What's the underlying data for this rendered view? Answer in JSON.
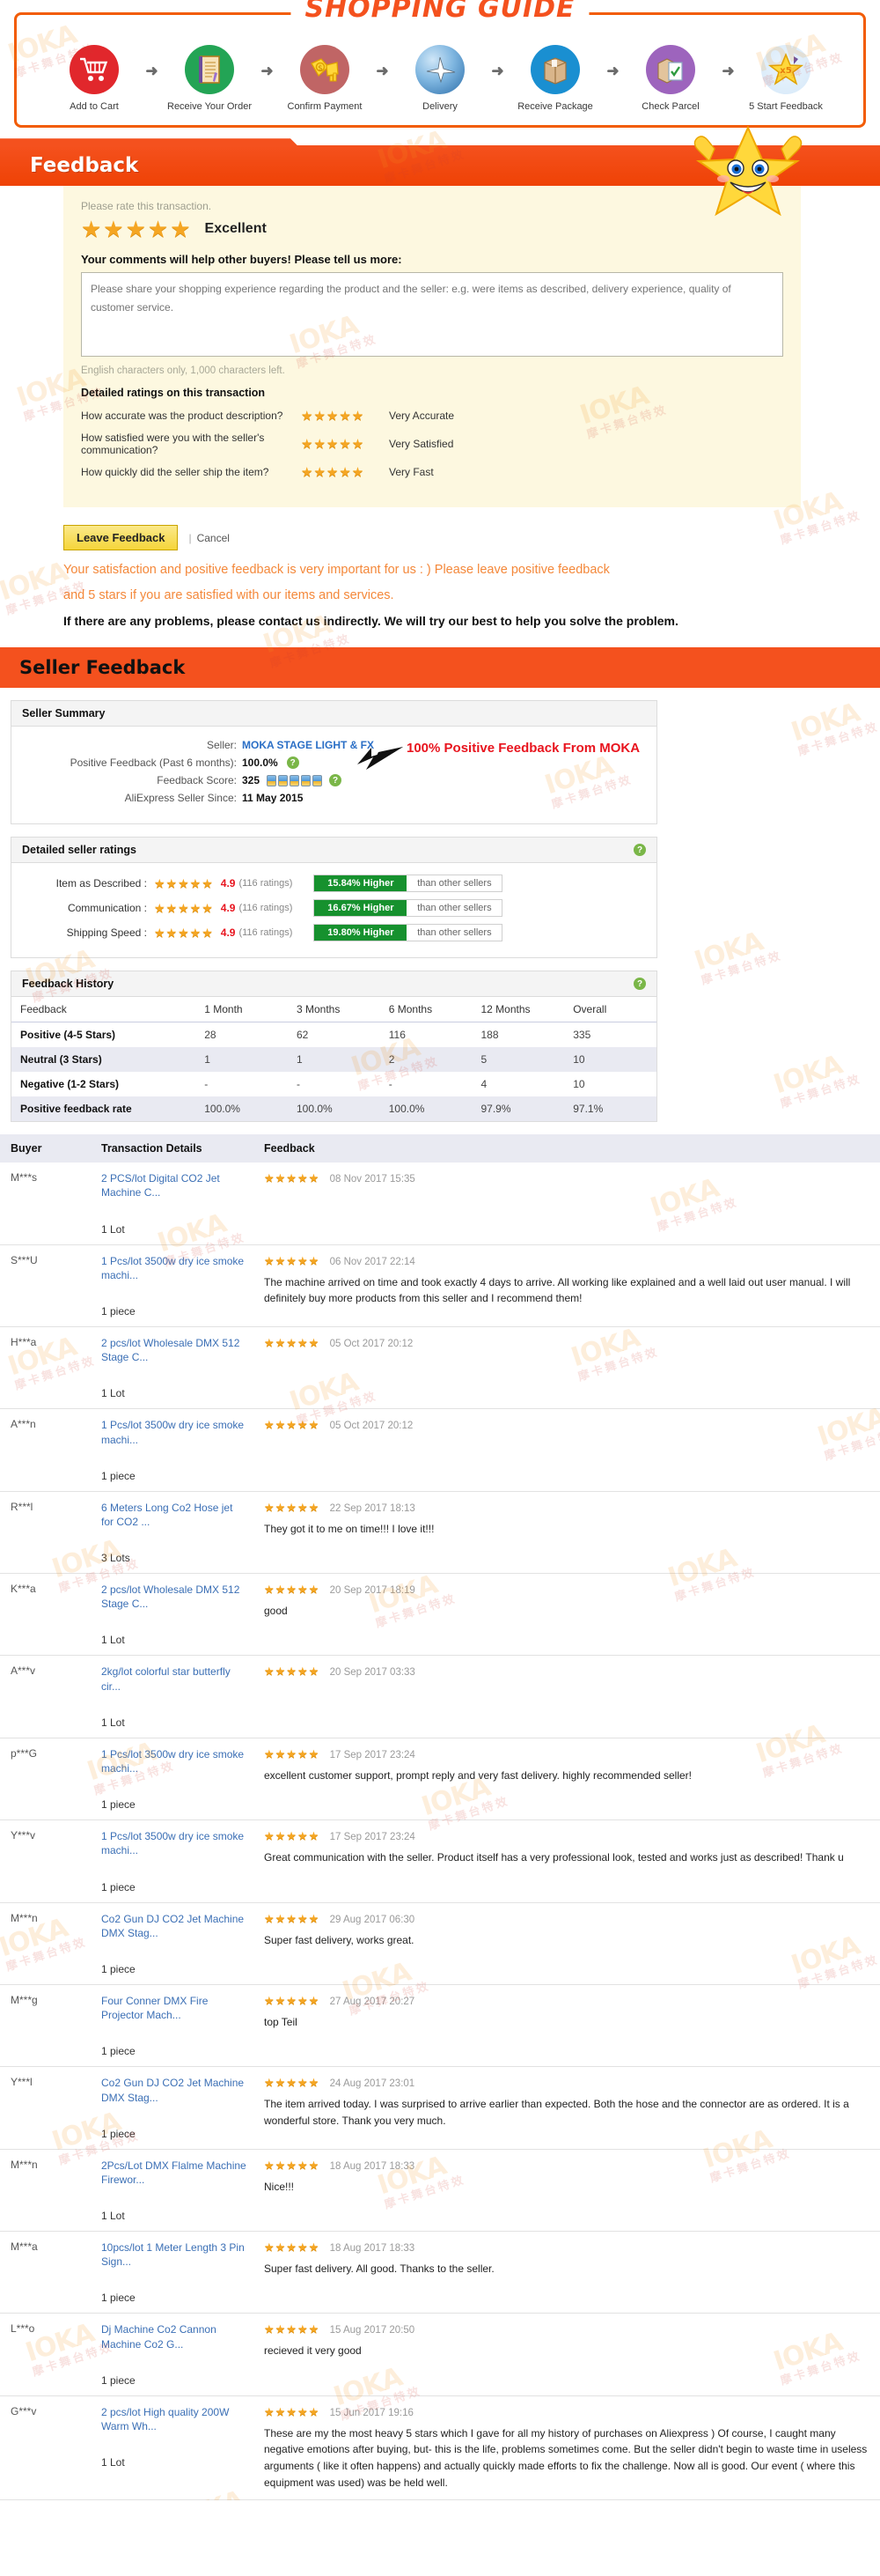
{
  "guide": {
    "title": "SHOPPING GUIDE",
    "steps": [
      {
        "label": "Add to Cart",
        "icon": "shopping-cart-icon"
      },
      {
        "label": "Receive Your Order",
        "icon": "order-document-icon"
      },
      {
        "label": "Confirm Payment",
        "icon": "money-payment-icon"
      },
      {
        "label": "Delivery",
        "icon": "airplane-globe-icon"
      },
      {
        "label": "Receive Package",
        "icon": "parcel-box-icon"
      },
      {
        "label": "Check Parcel",
        "icon": "checklist-parcel-icon"
      },
      {
        "label": "5 Start Feedback",
        "icon": "five-star-icon"
      }
    ],
    "arrow": "➜"
  },
  "feedback_section": {
    "bar_title": "Feedback",
    "rate_hint": "Please rate this transaction.",
    "stars": "★★★★★",
    "rating_word": "Excellent",
    "comments_lead": "Your comments will help other buyers! Please tell us more:",
    "comment_placeholder": "Please share your shopping experience regarding the product and the seller: e.g. were items as described, delivery experience, quality of customer service.",
    "comment_value": "",
    "chars_left": "English characters only, 1,000 characters left.",
    "detailed_head": "Detailed ratings on this transaction",
    "detailed": [
      {
        "question": "How accurate was the product description?",
        "stars": "★★★★★",
        "answer": "Very Accurate"
      },
      {
        "question": "How satisfied were you with the seller's communication?",
        "stars": "★★★★★",
        "answer": "Very Satisfied"
      },
      {
        "question": "How quickly did the seller ship the item?",
        "stars": "★★★★★",
        "answer": "Very Fast"
      }
    ],
    "leave_feedback_label": "Leave Feedback",
    "cancel_label": "Cancel",
    "note_orange_line1": "Your satisfaction and positive feedback is very important for us : ) Please leave positive feedback",
    "note_orange_line2": "and 5 stars if you are satisfied with our items and services.",
    "note_black": "If there are any problems, please contact us indirectly. We will try our best to help you solve the problem."
  },
  "seller_feedback": {
    "bar_title": "Seller Feedback",
    "summary": {
      "panel_title": "Seller Summary",
      "rows": [
        {
          "label": "Seller:",
          "value": "MOKA STAGE LIGHT & FX",
          "is_link": true
        },
        {
          "label": "Positive Feedback (Past 6 months):",
          "value": "100.0%",
          "help": true
        },
        {
          "label": "Feedback Score:",
          "value": "325",
          "medals": 5,
          "help": true
        },
        {
          "label": "AliExpress Seller Since:",
          "value": "11 May 2015"
        }
      ],
      "annotation": "100% Positive Feedback From MOKA"
    },
    "dsr": {
      "panel_title": "Detailed seller ratings",
      "rows": [
        {
          "label": "Item as Described :",
          "stars": "★★★★★",
          "score": "4.9",
          "count": "(116 ratings)",
          "higher": "15.84% Higher",
          "rest": "than other sellers"
        },
        {
          "label": "Communication :",
          "stars": "★★★★★",
          "score": "4.9",
          "count": "(116 ratings)",
          "higher": "16.67% Higher",
          "rest": "than other sellers"
        },
        {
          "label": "Shipping Speed :",
          "stars": "★★★★★",
          "score": "4.9",
          "count": "(116 ratings)",
          "higher": "19.80% Higher",
          "rest": "than other sellers"
        }
      ]
    },
    "history": {
      "panel_title": "Feedback History",
      "columns": [
        "Feedback",
        "1 Month",
        "3 Months",
        "6 Months",
        "12 Months",
        "Overall"
      ],
      "rows": [
        [
          "Positive (4-5 Stars)",
          "28",
          "62",
          "116",
          "188",
          "335"
        ],
        [
          "Neutral (3 Stars)",
          "1",
          "1",
          "2",
          "5",
          "10"
        ],
        [
          "Negative (1-2 Stars)",
          "-",
          "-",
          "-",
          "4",
          "10"
        ],
        [
          "Positive feedback rate",
          "100.0%",
          "100.0%",
          "100.0%",
          "97.9%",
          "97.1%"
        ]
      ]
    }
  },
  "feedback_list": {
    "columns": [
      "Buyer",
      "Transaction Details",
      "Feedback"
    ],
    "rows": [
      {
        "buyer": "M***s",
        "product": "2 PCS/lot Digital CO2 Jet Machine C...",
        "qty": "1 Lot",
        "stars": "★★★★★",
        "date": "08 Nov 2017 15:35",
        "text": ""
      },
      {
        "buyer": "S***U",
        "product": "1 Pcs/lot 3500w dry ice smoke machi...",
        "qty": "1 piece",
        "stars": "★★★★★",
        "date": "06 Nov 2017 22:14",
        "text": "The machine arrived on time and took exactly 4 days to arrive. All working like explained and a well laid out user manual. I will definitely buy more products from this seller and I recommend them!"
      },
      {
        "buyer": "H***a",
        "product": "2 pcs/lot Wholesale DMX 512 Stage C...",
        "qty": "1 Lot",
        "stars": "★★★★★",
        "date": "05 Oct 2017 20:12",
        "text": ""
      },
      {
        "buyer": "A***n",
        "product": "1 Pcs/lot 3500w dry ice smoke machi...",
        "qty": "1 piece",
        "stars": "★★★★★",
        "date": "05 Oct 2017 20:12",
        "text": ""
      },
      {
        "buyer": "R***l",
        "product": "6 Meters Long Co2 Hose jet for CO2 ...",
        "qty": "3 Lots",
        "stars": "★★★★★",
        "date": "22 Sep 2017 18:13",
        "text": "They got it to me on time!!! I love it!!!"
      },
      {
        "buyer": "K***a",
        "product": "2 pcs/lot Wholesale DMX 512 Stage C...",
        "qty": "1 Lot",
        "stars": "★★★★★",
        "date": "20 Sep 2017 18:19",
        "text": "good"
      },
      {
        "buyer": "A***v",
        "product": "2kg/lot colorful star butterfly cir...",
        "qty": "1 Lot",
        "stars": "★★★★★",
        "date": "20 Sep 2017 03:33",
        "text": ""
      },
      {
        "buyer": "p***G",
        "product": "1 Pcs/lot 3500w dry ice smoke machi...",
        "qty": "1 piece",
        "stars": "★★★★★",
        "date": "17 Sep 2017 23:24",
        "text": "excellent customer support, prompt reply and very fast delivery. highly recommended seller!"
      },
      {
        "buyer": "Y***v",
        "product": "1 Pcs/lot 3500w dry ice smoke machi...",
        "qty": "1 piece",
        "stars": "★★★★★",
        "date": "17 Sep 2017 23:24",
        "text": "Great communication with the seller. Product itself has a very professional look, tested and works just as described! Thank u"
      },
      {
        "buyer": "M***n",
        "product": "Co2 Gun DJ CO2 Jet Machine DMX Stag...",
        "qty": "1 piece",
        "stars": "★★★★★",
        "date": "29 Aug 2017 06:30",
        "text": "Super fast delivery, works great."
      },
      {
        "buyer": "M***g",
        "product": "Four Conner DMX Fire Projector Mach...",
        "qty": "1 piece",
        "stars": "★★★★★",
        "date": "27 Aug 2017 20:27",
        "text": "top Teil"
      },
      {
        "buyer": "Y***l",
        "product": "Co2 Gun DJ CO2 Jet Machine DMX Stag...",
        "qty": "1 piece",
        "stars": "★★★★★",
        "date": "24 Aug 2017 23:01",
        "text": "The item arrived today. I was surprised to arrive earlier than expected. Both the hose and the connector are as ordered. It is a wonderful store. Thank you very much."
      },
      {
        "buyer": "M***n",
        "product": "2Pcs/Lot DMX Flalme Machine Firewor...",
        "qty": "1 Lot",
        "stars": "★★★★★",
        "date": "18 Aug 2017 18:33",
        "text": "Nice!!!"
      },
      {
        "buyer": "M***a",
        "product": "10pcs/lot 1 Meter Length 3 Pin Sign...",
        "qty": "1 piece",
        "stars": "★★★★★",
        "date": "18 Aug 2017 18:33",
        "text": "Super fast delivery. All good. Thanks to the seller."
      },
      {
        "buyer": "L***o",
        "product": "Dj Machine Co2 Cannon Machine Co2 G...",
        "qty": "1 piece",
        "stars": "★★★★★",
        "date": "15 Aug 2017 20:50",
        "text": "recieved it very good"
      },
      {
        "buyer": "G***v",
        "product": "2 pcs/lot High quality 200W Warm Wh...",
        "qty": "1 Lot",
        "stars": "★★★★★",
        "date": "15 Jun 2017 19:16",
        "text": "These are my the most heavy 5 stars which I gave for all my history of purchases on Aliexpress ) Of course, I caught many negative emotions after buying, but- this is the life, problems sometimes come. But the seller didn't begin to waste time in useless arguments ( like it often happens) and actually quickly made efforts to fix the challenge. Now all is good. Our event ( where this equipment was used) was be held well."
      }
    ]
  },
  "colors": {
    "orange": "#f4511e",
    "star": "#f5a623",
    "green": "#16912e",
    "link": "#3b6fb5",
    "red": "#e8141e",
    "cream": "#fdf8e0"
  },
  "watermark": {
    "text": "IOKA",
    "sub": "摩卡舞台特效"
  }
}
